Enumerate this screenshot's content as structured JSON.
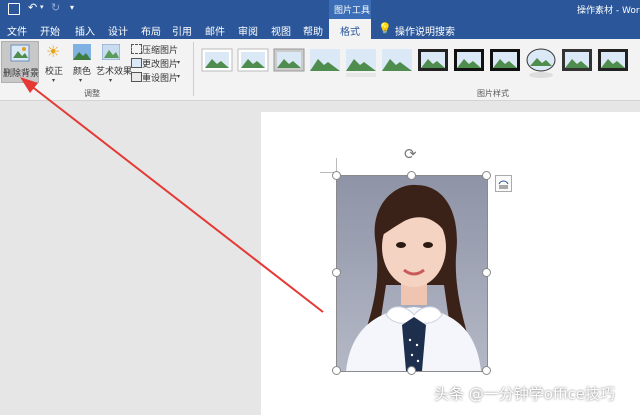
{
  "titlebar": {
    "picture_tools_label": "图片工具",
    "doc_title": "操作素材 - Word"
  },
  "tabs": [
    {
      "label": "文件"
    },
    {
      "label": "开始"
    },
    {
      "label": "插入"
    },
    {
      "label": "设计"
    },
    {
      "label": "布局"
    },
    {
      "label": "引用"
    },
    {
      "label": "邮件"
    },
    {
      "label": "审阅"
    },
    {
      "label": "视图"
    },
    {
      "label": "帮助"
    },
    {
      "label": "格式"
    }
  ],
  "tell_me": "操作说明搜索",
  "ribbon": {
    "remove_bg": "删除背景",
    "corrections": "校正",
    "color": "颜色",
    "artistic": "艺术效果",
    "compress": "压缩图片",
    "change": "更改图片",
    "reset": "重设图片",
    "group_adjust": "调整",
    "group_styles": "图片样式"
  },
  "watermark": "头条 @一分钟学office技巧",
  "colors": {
    "accent": "#2b579a",
    "arrow": "#e53935"
  }
}
